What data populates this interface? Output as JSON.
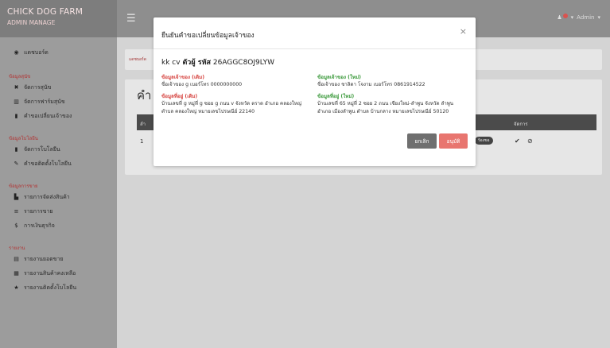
{
  "brand": {
    "title": "CHICK DOG FARM",
    "subtitle": "ADMIN MANAGE"
  },
  "topbar": {
    "user": "Admin"
  },
  "sidebar": {
    "dashboard": "แดชบอร์ด",
    "group1": "ข้อมูลสุนัข",
    "items1": [
      "จัดการสุนัข",
      "จัดการฟาร์มสุนัข",
      "คำขอเปลี่ยนเจ้าของ"
    ],
    "group2": "ข้อมูลโบโลยีน",
    "items2": [
      "จัดการโบโลยีน",
      "คำขอติดตั้งโบโลยีน"
    ],
    "group3": "ข้อมูลการขาย",
    "items3": [
      "รายการจัดส่งสินค้า",
      "รายการขาย",
      "การเงินธุรกิจ"
    ],
    "group4": "รายงาน",
    "items4": [
      "รายงานยอดขาย",
      "รายงานสินค้าคงเหลือ",
      "รายงานติดตั้งโบโลยีน"
    ]
  },
  "content": {
    "breadcrumb": "แดชบอร์ด",
    "panel_title": "คำ",
    "table_header_first": "ลำ",
    "table_header_action": "จัดการ",
    "row_index": "1",
    "row_pill": "ร้องขอ"
  },
  "modal": {
    "title": "ยืนยันคำขอเปลี่ยนข้อมูลเจ้าของ",
    "subtitle_prefix": "kk cv",
    "subtitle_bold": "ตัวผู้ รหัส",
    "subtitle_code": "26AGGC8OJ9LYW",
    "owner_old_label": "ข้อมูลเจ้าของ (เดิม)",
    "owner_old_value": "ชื่อเจ้าของ g เบอร์โทร 0000000000",
    "addr_old_label": "ข้อมูลที่อยู่ (เดิม)",
    "addr_old_value": "บ้านเลขที่ g หมู่ที่ g ซอย g ถนน v จังหวัด ตราด อำเภอ คลองใหญ่ ตำบล คลองใหญ่ หมายเลขไปรษณีย์ 22140",
    "owner_new_label": "ข้อมูลเจ้าของ (ใหม่)",
    "owner_new_value": "ชื่อเจ้าของ ชาลิดา โจงาม เบอร์โทร 0861914522",
    "addr_new_label": "ข้อมูลที่อยู่ (ใหม่)",
    "addr_new_value": "บ้านเลขที่ 65 หมู่ที่ 2 ซอย 2 ถนน เชียงใหม่-ลำพูน จังหวัด ลำพูน อำเภอ เมืองลำพูน ตำบล บ้านกลาง หมายเลขไปรษณีย์ 50120",
    "cancel_label": "ยกเลิก",
    "approve_label": "อนุมัติ"
  }
}
